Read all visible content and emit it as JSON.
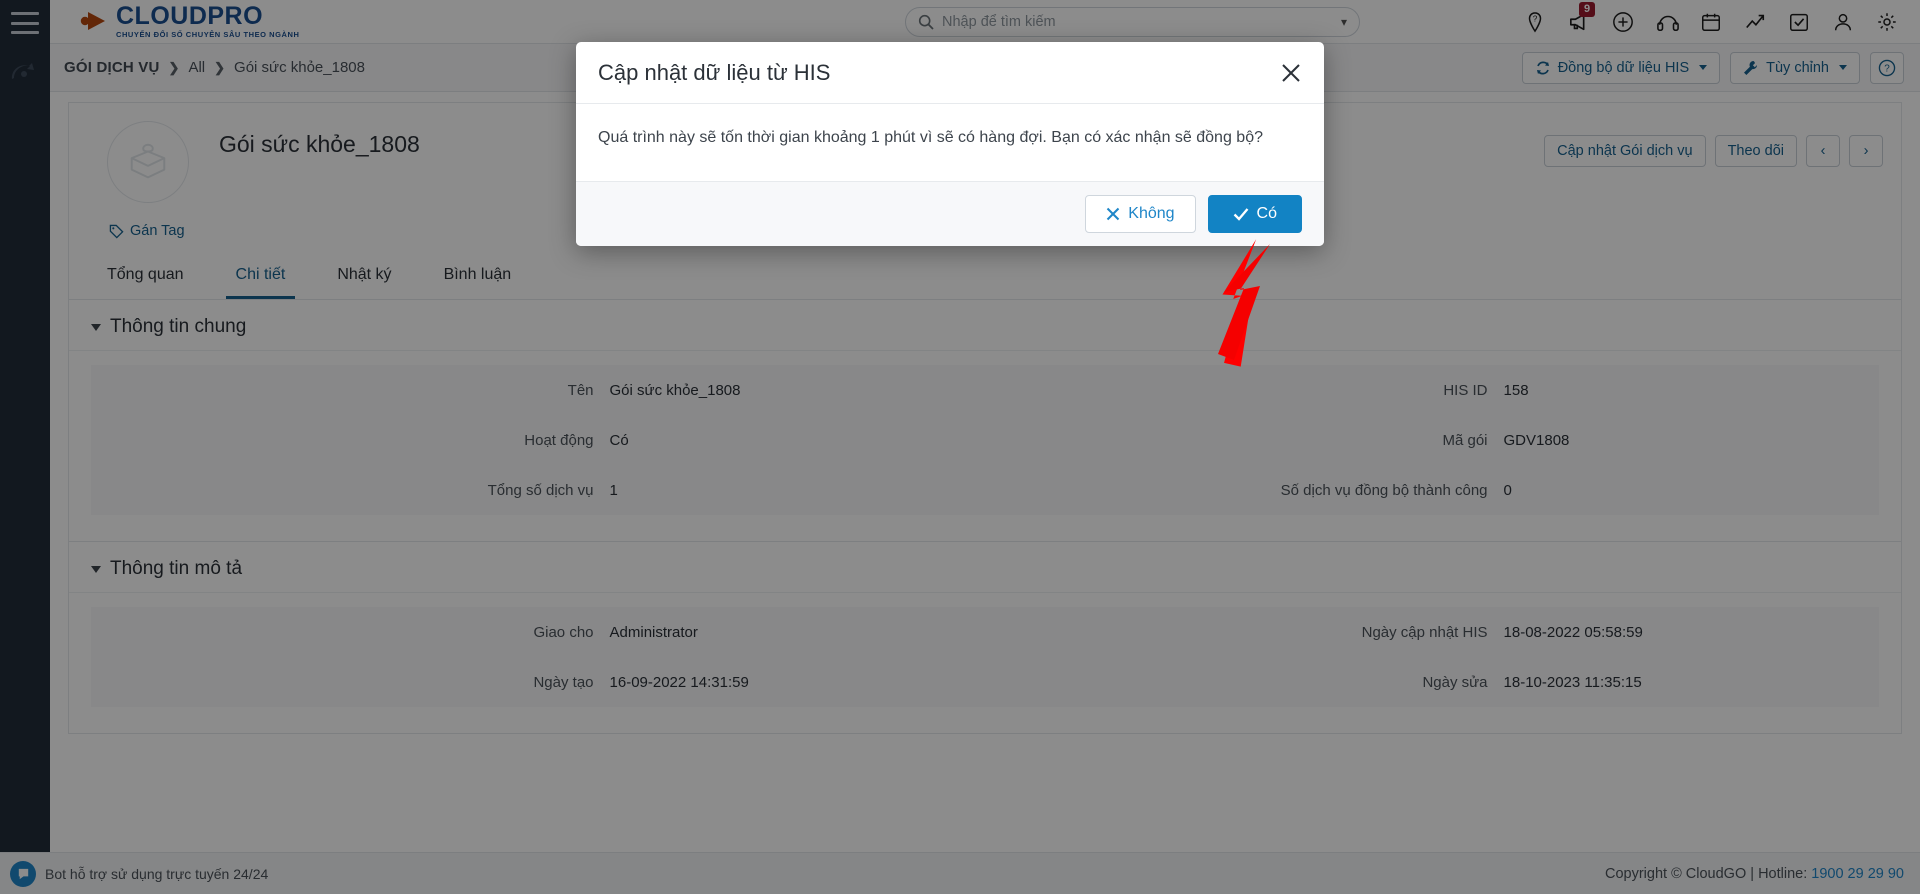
{
  "brand": {
    "name": "CLOUDPRO",
    "tagline": "CHUYỂN ĐỔI SỐ CHUYÊN SÂU THEO NGÀNH",
    "blue": "#1b4f91",
    "orange": "#b5480f"
  },
  "header": {
    "search_placeholder": "Nhập để tìm kiếm",
    "icons": [
      {
        "name": "location-help-icon",
        "glyph": "location"
      },
      {
        "name": "announcement-icon",
        "glyph": "megaphone",
        "badge": "9"
      },
      {
        "name": "add-icon",
        "glyph": "plus"
      },
      {
        "name": "support-icon",
        "glyph": "support"
      },
      {
        "name": "calendar-icon",
        "glyph": "calendar"
      },
      {
        "name": "report-icon",
        "glyph": "chart"
      },
      {
        "name": "task-icon",
        "glyph": "checkbox"
      },
      {
        "name": "user-icon",
        "glyph": "person"
      },
      {
        "name": "settings-icon",
        "glyph": "gear"
      }
    ]
  },
  "breadcrumb": {
    "root": "GÓI DỊCH VỤ",
    "sep": "❯",
    "mid": "All",
    "last": "Gói sức khỏe_1808"
  },
  "toolbar": {
    "sync_label": "Đồng bộ dữ liệu HIS",
    "custom_label": "Tùy chỉnh",
    "help_label": "?"
  },
  "record": {
    "title": "Gói sức khỏe_1808",
    "tag_label": "Gán Tag",
    "update_label": "Cập nhật Gói dịch vụ",
    "follow_label": "Theo dõi",
    "prev_label": "‹",
    "next_label": "›"
  },
  "tabs": [
    {
      "label": "Tổng quan",
      "active": false
    },
    {
      "label": "Chi tiết",
      "active": true
    },
    {
      "label": "Nhật ký",
      "active": false
    },
    {
      "label": "Bình luận",
      "active": false
    }
  ],
  "sections": [
    {
      "title": "Thông tin chung",
      "left": [
        {
          "label": "Tên",
          "value": "Gói sức khỏe_1808"
        },
        {
          "label": "Hoạt động",
          "value": "Có"
        },
        {
          "label": "Tổng số dịch vụ",
          "value": "1"
        }
      ],
      "right": [
        {
          "label": "HIS ID",
          "value": "158"
        },
        {
          "label": "Mã gói",
          "value": "GDV1808"
        },
        {
          "label": "Số dịch vụ đồng bộ thành công",
          "value": "0"
        }
      ]
    },
    {
      "title": "Thông tin mô tả",
      "left": [
        {
          "label": "Giao cho",
          "value": "Administrator"
        },
        {
          "label": "Ngày tạo",
          "value": "16-09-2022 14:31:59"
        }
      ],
      "right": [
        {
          "label": "Ngày cập nhật HIS",
          "value": "18-08-2022 05:58:59"
        },
        {
          "label": "Ngày sửa",
          "value": "18-10-2023 11:35:15"
        }
      ]
    }
  ],
  "modal": {
    "title": "Cập nhật dữ liệu từ HIS",
    "body": "Quá trình này sẽ tốn thời gian khoảng 1 phút vì sẽ có hàng đợi. Bạn có xác nhận sẽ đồng bộ?",
    "cancel_label": "Không",
    "confirm_label": "Có"
  },
  "footer": {
    "support_text": "Bot hỗ trợ sử dụng trực tuyến 24/24",
    "copyright": "Copyright © CloudGO | Hotline: ",
    "hotline": "1900 29 29 90"
  }
}
